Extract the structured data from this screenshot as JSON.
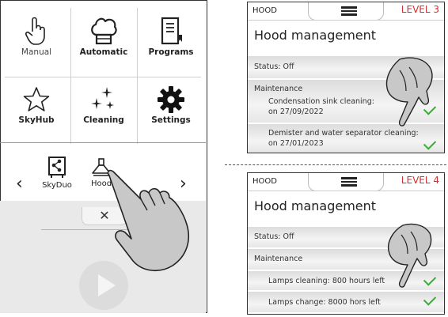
{
  "left_device": {
    "tiles": [
      {
        "label": "Manual",
        "icon": "hand-pointer-icon"
      },
      {
        "label": "Automatic",
        "icon": "chef-hat-icon"
      },
      {
        "label": "Programs",
        "icon": "book-icon"
      },
      {
        "label": "SkyHub",
        "icon": "star-icon"
      },
      {
        "label": "Cleaning",
        "icon": "sparkles-icon"
      },
      {
        "label": "Settings",
        "icon": "gear-icon"
      }
    ],
    "carousel": {
      "prev": "‹",
      "next": "›",
      "items": [
        {
          "label": "SkyDuo",
          "icon": "share-icon"
        },
        {
          "label": "Hood",
          "icon": "hood-icon"
        }
      ]
    },
    "close_symbol": "✕",
    "play_icon": "play-icon"
  },
  "panels": [
    {
      "header_label": "HOOD",
      "level": "LEVEL 3",
      "title": "Hood management",
      "status": "Status: Off",
      "maintenance": "Maintenance",
      "items": [
        {
          "line1": "Condensation sink cleaning:",
          "line2": "on 27/09/2022"
        },
        {
          "line1": "Demister and water separator cleaning:",
          "line2": "on 27/01/2023"
        }
      ]
    },
    {
      "header_label": "HOOD",
      "level": "LEVEL 4",
      "title": "Hood management",
      "status": "Status: Off",
      "maintenance": "Maintenance",
      "items": [
        {
          "line1": "Lamps cleaning: 800 hours left"
        },
        {
          "line1": "Lamps change: 8000 hors left"
        }
      ]
    }
  ],
  "colors": {
    "accent_red": "#d32f2f",
    "check_green": "#3aaa35"
  }
}
